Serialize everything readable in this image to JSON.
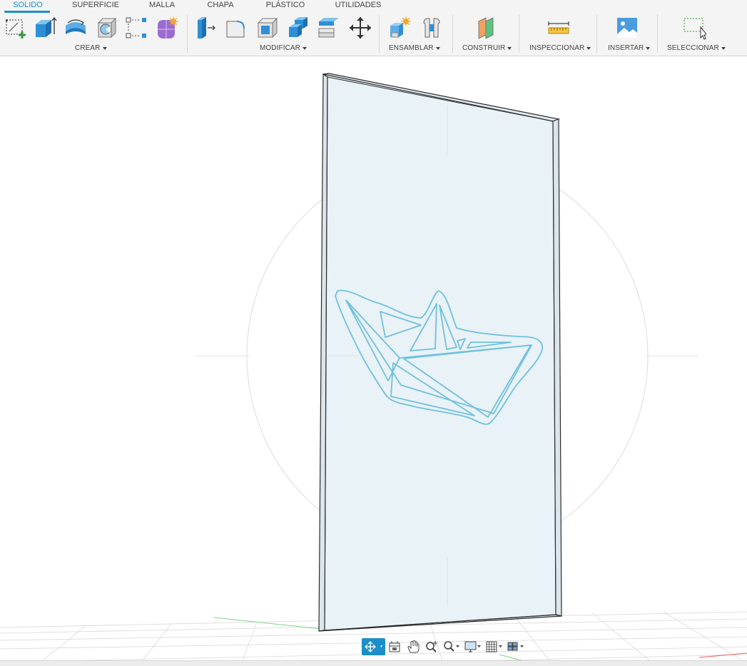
{
  "tabs": [
    {
      "label": "SOLIDO",
      "active": true
    },
    {
      "label": "SUPERFICIE",
      "active": false
    },
    {
      "label": "MALLA",
      "active": false
    },
    {
      "label": "CHAPA",
      "active": false
    },
    {
      "label": "PLÁSTICO",
      "active": false
    },
    {
      "label": "UTILIDADES",
      "active": false
    }
  ],
  "groups": {
    "crear": "CREAR",
    "modificar": "MODIFICAR",
    "ensamblar": "ENSAMBLAR",
    "construir": "CONSTRUIR",
    "inspeccionar": "INSPECCIONAR",
    "insertar": "INSERTAR",
    "seleccionar": "SELECCIONAR"
  },
  "colors": {
    "accent": "#1a8fc9",
    "sketch_line": "#6ec1de",
    "panel_fill": "#e9f2f7",
    "panel_edge": "#2c2c2c"
  },
  "icons": {
    "crear": [
      "create-sketch-icon",
      "extrude-icon",
      "revolve-icon",
      "hole-icon",
      "pattern-icon",
      "create-form-icon"
    ],
    "modificar": [
      "press-pull-icon",
      "fillet-icon",
      "shell-icon",
      "combine-icon",
      "offset-face-icon",
      "move-icon"
    ],
    "ensamblar": [
      "new-component-icon",
      "joint-icon"
    ],
    "construir": [
      "offset-plane-icon"
    ],
    "inspeccionar": [
      "measure-icon"
    ],
    "insertar": [
      "insert-image-icon"
    ],
    "seleccionar": [
      "window-select-icon"
    ]
  },
  "navbar": [
    "orbit-icon",
    "look-at-icon",
    "pan-icon",
    "zoom-icon",
    "fit-icon",
    "display-settings-icon",
    "grid-icon",
    "viewports-icon"
  ]
}
